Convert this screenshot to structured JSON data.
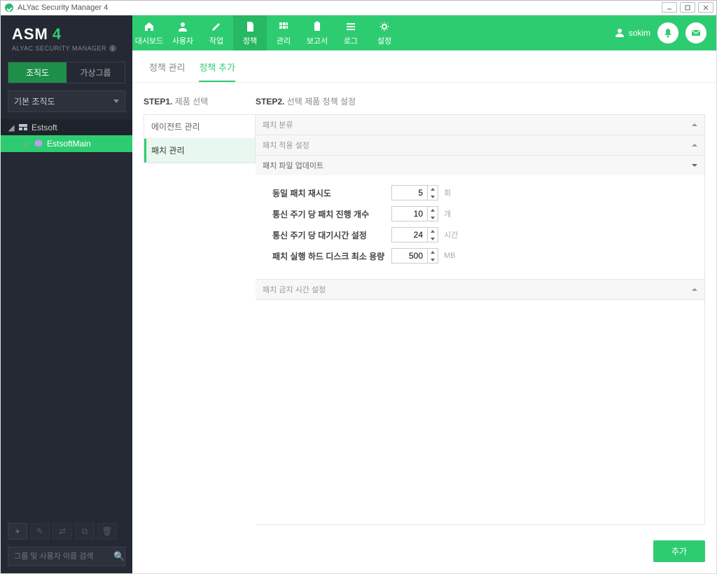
{
  "window": {
    "title": "ALYac Security Manager 4"
  },
  "brand": {
    "name": "ASM",
    "version": "4",
    "subtitle": "ALYAC SECURITY MANAGER"
  },
  "sidebar": {
    "tabs": {
      "org": "조직도",
      "virtual": "가상그룹"
    },
    "dropdown": "기본 조직도",
    "tree": {
      "root": "Estsoft",
      "child": "EstsoftMain"
    },
    "search_placeholder": "그룹 및 사용자 이름 검색"
  },
  "topnav": [
    {
      "label": "대시보드"
    },
    {
      "label": "사용자"
    },
    {
      "label": "작업"
    },
    {
      "label": "정책"
    },
    {
      "label": "관리"
    },
    {
      "label": "보고서"
    },
    {
      "label": "로그"
    },
    {
      "label": "설정"
    }
  ],
  "user": {
    "name": "sokim"
  },
  "subtabs": {
    "manage": "정책 관리",
    "add": "정책 추가"
  },
  "step1": {
    "title_prefix": "STEP1.",
    "title": "제품 선택",
    "items": {
      "agent": "에이전트 관리",
      "patch": "패치 관리"
    }
  },
  "step2": {
    "title_prefix": "STEP2.",
    "title": "선택 제품 정책 설정",
    "sections": {
      "classify": "패치 분류",
      "apply": "패치 적용 설정",
      "update": "패치 파일 업데이트",
      "block": "패치 금지 시간 설정"
    },
    "fields": {
      "retry": {
        "label": "동일 패치 재시도",
        "value": "5",
        "unit": "회"
      },
      "per_cycle": {
        "label": "통신 주기 당 패치 진행 개수",
        "value": "10",
        "unit": "개"
      },
      "wait": {
        "label": "통신 주기 당 대기시간 설정",
        "value": "24",
        "unit": "시간"
      },
      "disk": {
        "label": "패치 실행 하드 디스크 최소 용량",
        "value": "500",
        "unit": "MB"
      }
    }
  },
  "footer": {
    "add": "추가"
  }
}
